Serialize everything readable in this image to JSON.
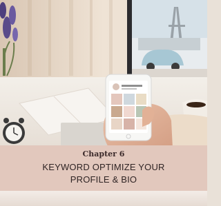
{
  "banner": {
    "chapter": "Chapter 6",
    "line1": "KEYWORD OPTIMIZE YOUR",
    "line2": "PROFILE & BIO"
  },
  "colors": {
    "banner_bg": "#e2c8bd",
    "banner_text": "#2f2424",
    "chapter_text": "#3b2a2a"
  }
}
